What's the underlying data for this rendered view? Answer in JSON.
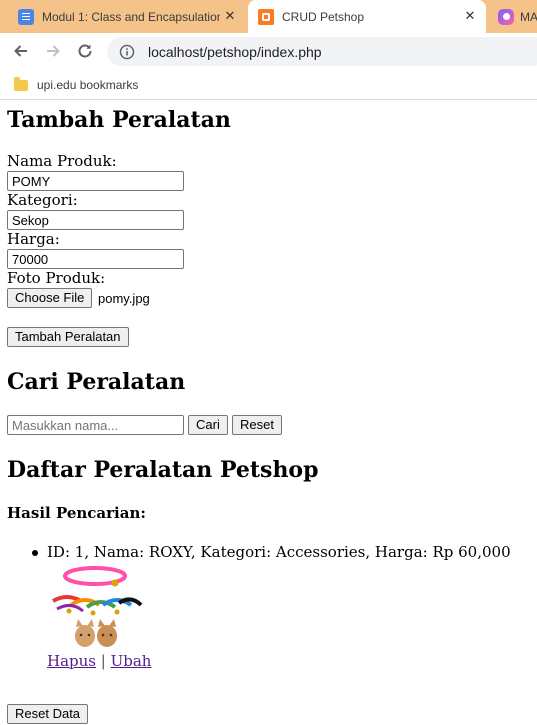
{
  "browser": {
    "tabs": [
      {
        "title": "Modul 1: Class and Encapsulation",
        "close": "✕",
        "icon": "docs-icon"
      },
      {
        "title": "CRUD Petshop",
        "close": "✕",
        "icon": "xampp-icon"
      },
      {
        "title": "MA",
        "icon": "app-icon"
      }
    ],
    "url": "localhost/petshop/index.php",
    "bookmark": "upi.edu bookmarks"
  },
  "form": {
    "heading": "Tambah Peralatan",
    "name_label": "Nama Produk:",
    "name_value": "POMY",
    "category_label": "Kategori:",
    "category_value": "Sekop",
    "price_label": "Harga:",
    "price_value": "70000",
    "photo_label": "Foto Produk:",
    "choose_file": "Choose File",
    "file_name": "pomy.jpg",
    "submit": "Tambah Peralatan"
  },
  "search": {
    "heading": "Cari Peralatan",
    "placeholder": "Masukkan nama...",
    "search_button": "Cari",
    "reset_button": "Reset"
  },
  "list": {
    "heading": "Daftar Peralatan Petshop",
    "result_heading": "Hasil Pencarian:",
    "items": [
      {
        "text": "ID: 1, Nama: ROXY, Kategori: Accessories, Harga: Rp 60,000",
        "delete": "Hapus",
        "separator": "|",
        "edit": "Ubah"
      }
    ]
  },
  "reset_data": "Reset Data"
}
